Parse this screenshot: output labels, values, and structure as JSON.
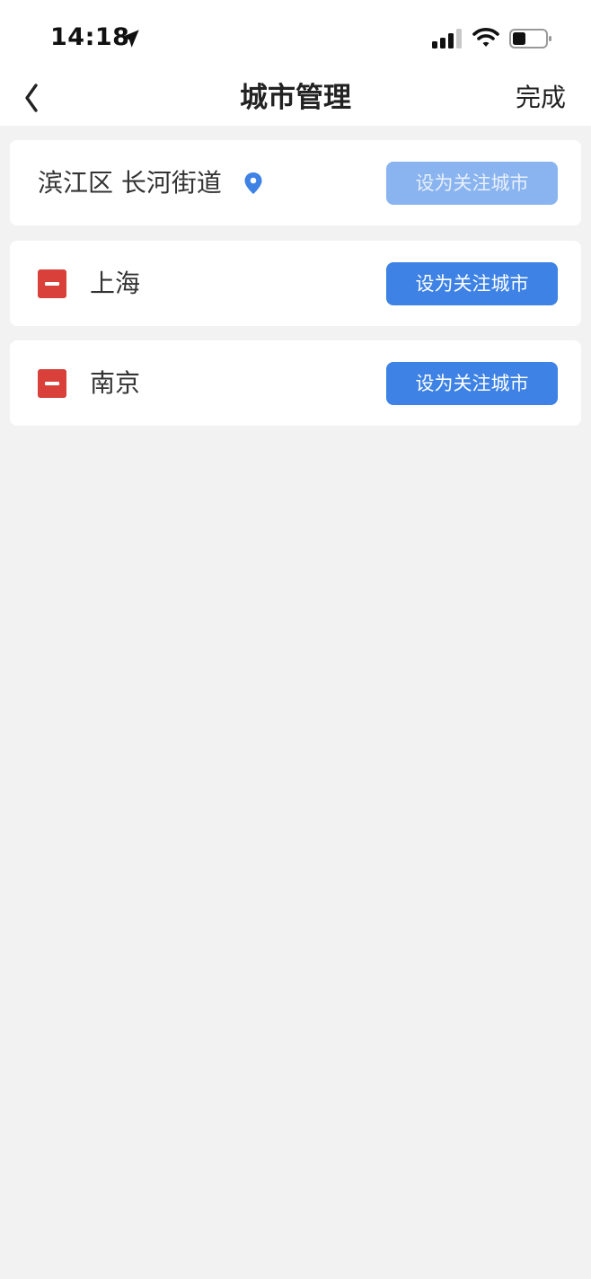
{
  "status_bar": {
    "time": "14:18",
    "icons": [
      "location-arrow-icon",
      "cellular-signal-icon",
      "wifi-icon",
      "battery-icon"
    ]
  },
  "nav": {
    "back_icon": "chevron-left-icon",
    "title": "城市管理",
    "done_label": "完成"
  },
  "current_location": {
    "name": "滨江区 长河街道",
    "icon": "location-pin-icon",
    "button_label": "设为关注城市",
    "button_disabled": true
  },
  "cities": [
    {
      "name": "上海",
      "button_label": "设为关注城市"
    },
    {
      "name": "南京",
      "button_label": "设为关注城市"
    }
  ],
  "colors": {
    "accent": "#3d82e4",
    "accent_disabled": "#8ab4ef",
    "remove": "#d9403a",
    "background": "#f2f2f2"
  }
}
